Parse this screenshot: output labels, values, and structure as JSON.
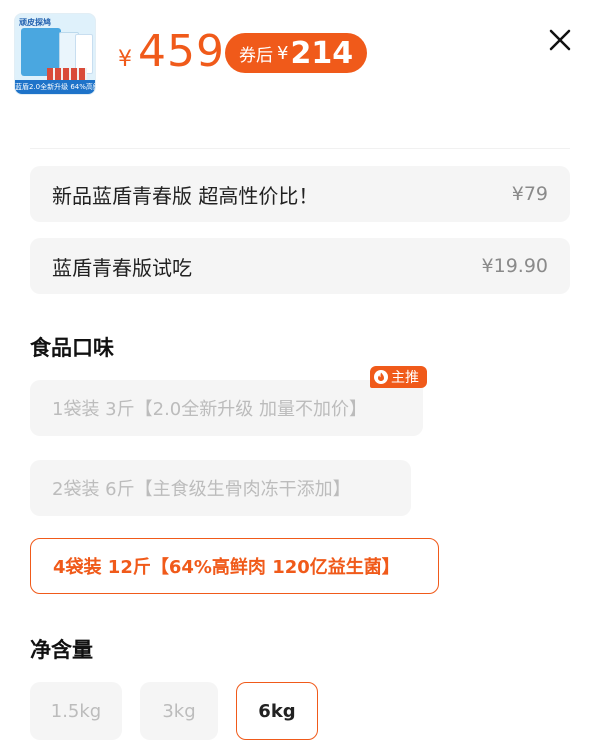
{
  "product": {
    "thumb_brand": "顽皮探鸠",
    "thumb_banner": "蓝盾2.0全新升级 64%高鲜肉",
    "price_currency": "¥",
    "price": "459",
    "coupon_label": "券后",
    "coupon_currency": "¥",
    "coupon_price": "214"
  },
  "addons": [
    {
      "title": "新品蓝盾青春版 超高性价比！",
      "price": "¥79"
    },
    {
      "title": "蓝盾青春版试吃",
      "price": "¥19.90"
    }
  ],
  "flavor": {
    "title": "食品口味",
    "recommend_tag": "主推",
    "options": [
      {
        "label": "1袋装 3斤【2.0全新升级 加量不加价】",
        "selected": false
      },
      {
        "label": "2袋装 6斤【主食级生骨肉冻干添加】",
        "selected": false
      },
      {
        "label": "4袋装 12斤【64%高鲜肉 120亿益生菌】",
        "selected": true
      }
    ]
  },
  "net_weight": {
    "title": "净含量",
    "options": [
      {
        "label": "1.5kg",
        "selected": false
      },
      {
        "label": "3kg",
        "selected": false
      },
      {
        "label": "6kg",
        "selected": true
      }
    ]
  },
  "colors": {
    "accent": "#f05a1a",
    "card_bg": "#f5f5f5",
    "muted_text": "#bcbcbc"
  },
  "icons": {
    "close": "close-icon",
    "flame": "flame-icon"
  }
}
